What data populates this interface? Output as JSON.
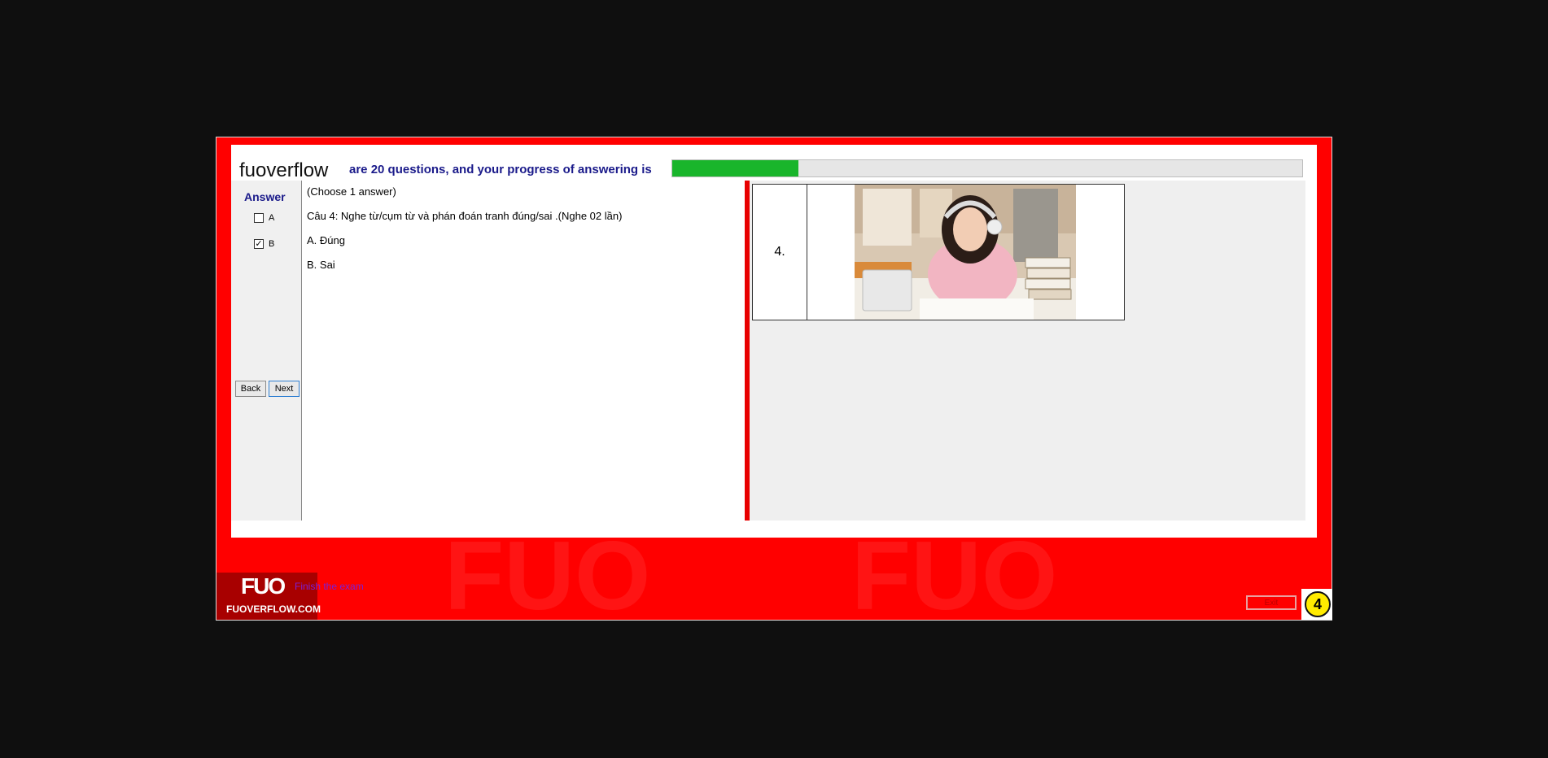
{
  "header": {
    "logo_text": "fuoverflow",
    "progress_text": "are 20 questions, and your progress of answering is",
    "progress_fraction": 0.2
  },
  "answer_panel": {
    "title": "Answer",
    "options": [
      {
        "label": "A",
        "checked": false
      },
      {
        "label": "B",
        "checked": true
      }
    ],
    "back_label": "Back",
    "next_label": "Next"
  },
  "question": {
    "instruction": "(Choose 1 answer)",
    "text": "Câu 4: Nghe từ/cụm từ và phán đoán tranh đúng/sai .(Nghe 02 lần)",
    "choices": [
      "A.  Đúng",
      "B.  Sai"
    ]
  },
  "image_panel": {
    "number_label": "4."
  },
  "footer": {
    "badge_main": "FUO",
    "badge_sub": "FUOVERFLOW.COM",
    "finish_label": "Finish the exam",
    "exit_label": "Exit",
    "question_badge": "4"
  },
  "colors": {
    "frame": "#ff0000",
    "progress": "#19b52b",
    "title": "#1a1a8a",
    "badge": "#ffeb00"
  }
}
